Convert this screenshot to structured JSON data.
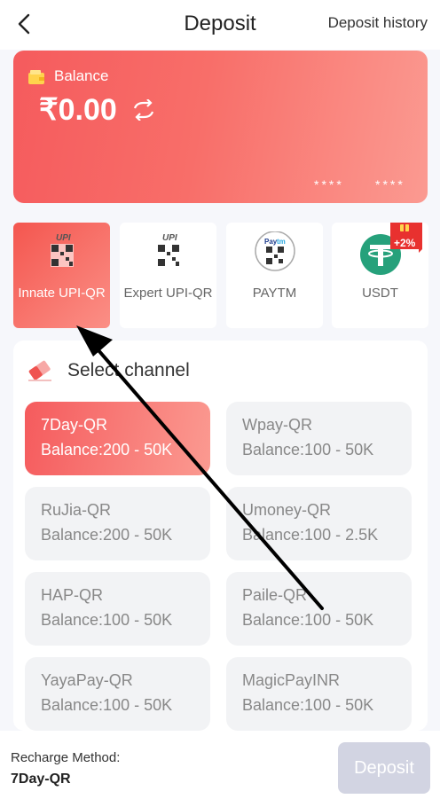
{
  "header": {
    "title": "Deposit",
    "history_label": "Deposit history"
  },
  "balance": {
    "label": "Balance",
    "amount": "₹0.00",
    "mask_left": "****",
    "mask_right": "****"
  },
  "methods": [
    {
      "label": "Innate UPI-QR",
      "icon": "upi-qr-icon"
    },
    {
      "label": "Expert UPI-QR",
      "icon": "upi-qr-icon"
    },
    {
      "label": "PAYTM",
      "icon": "paytm-qr-icon"
    },
    {
      "label": "USDT",
      "icon": "tether-icon"
    }
  ],
  "bonus": {
    "text": "+2%"
  },
  "channel_section": {
    "title": "Select channel"
  },
  "channels": [
    {
      "name": "7Day-QR",
      "range": "Balance:200 - 50K"
    },
    {
      "name": "Wpay-QR",
      "range": "Balance:100 - 50K"
    },
    {
      "name": "RuJia-QR",
      "range": "Balance:200 - 50K"
    },
    {
      "name": "Umoney-QR",
      "range": "Balance:100 - 2.5K"
    },
    {
      "name": "HAP-QR",
      "range": "Balance:100 - 50K"
    },
    {
      "name": "Paile-QR",
      "range": "Balance:100 - 50K"
    },
    {
      "name": "YayaPay-QR",
      "range": "Balance:100 - 50K"
    },
    {
      "name": "MagicPayINR",
      "range": "Balance:100 - 50K"
    }
  ],
  "footer": {
    "method_label": "Recharge Method:",
    "method_value": "7Day-QR",
    "deposit_label": "Deposit"
  },
  "colors": {
    "accent": "#f55b5d",
    "accent_light": "#fb9a91",
    "disabled": "#d2d4e2",
    "tether": "#26a17b"
  }
}
